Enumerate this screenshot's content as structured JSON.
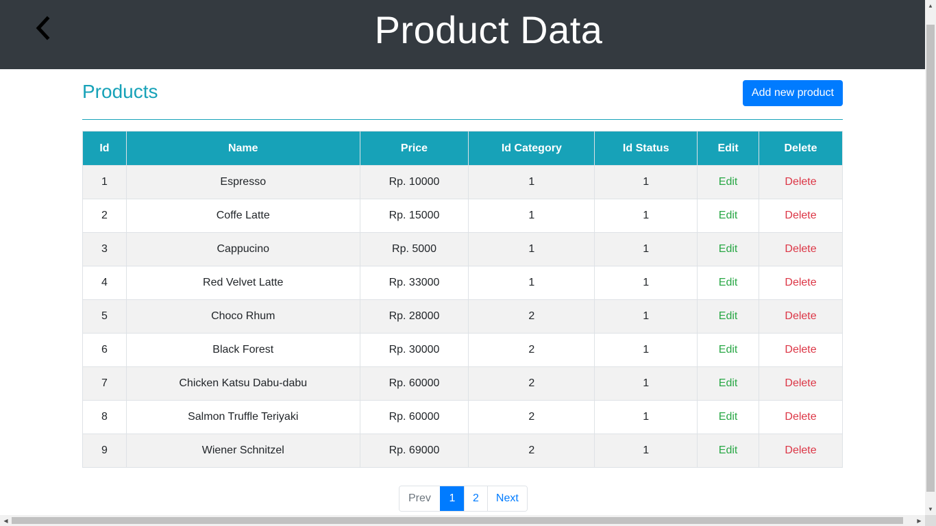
{
  "header": {
    "title": "Product Data",
    "back_icon": "chevron-left-icon"
  },
  "section": {
    "title": "Products",
    "add_button": "Add new product"
  },
  "table": {
    "columns": [
      "Id",
      "Name",
      "Price",
      "Id Category",
      "Id Status",
      "Edit",
      "Delete"
    ],
    "rows": [
      {
        "id": "1",
        "name": "Espresso",
        "price": "Rp. 10000",
        "category": "1",
        "status": "1",
        "edit": "Edit",
        "delete": "Delete"
      },
      {
        "id": "2",
        "name": "Coffe Latte",
        "price": "Rp. 15000",
        "category": "1",
        "status": "1",
        "edit": "Edit",
        "delete": "Delete"
      },
      {
        "id": "3",
        "name": "Cappucino",
        "price": "Rp. 5000",
        "category": "1",
        "status": "1",
        "edit": "Edit",
        "delete": "Delete"
      },
      {
        "id": "4",
        "name": "Red Velvet Latte",
        "price": "Rp. 33000",
        "category": "1",
        "status": "1",
        "edit": "Edit",
        "delete": "Delete"
      },
      {
        "id": "5",
        "name": "Choco Rhum",
        "price": "Rp. 28000",
        "category": "2",
        "status": "1",
        "edit": "Edit",
        "delete": "Delete"
      },
      {
        "id": "6",
        "name": "Black Forest",
        "price": "Rp. 30000",
        "category": "2",
        "status": "1",
        "edit": "Edit",
        "delete": "Delete"
      },
      {
        "id": "7",
        "name": "Chicken Katsu Dabu-dabu",
        "price": "Rp. 60000",
        "category": "2",
        "status": "1",
        "edit": "Edit",
        "delete": "Delete"
      },
      {
        "id": "8",
        "name": "Salmon Truffle Teriyaki",
        "price": "Rp. 60000",
        "category": "2",
        "status": "1",
        "edit": "Edit",
        "delete": "Delete"
      },
      {
        "id": "9",
        "name": "Wiener Schnitzel",
        "price": "Rp. 69000",
        "category": "2",
        "status": "1",
        "edit": "Edit",
        "delete": "Delete"
      }
    ]
  },
  "pagination": {
    "prev": "Prev",
    "pages": [
      "1",
      "2"
    ],
    "current": "1",
    "next": "Next"
  },
  "colors": {
    "header_bg": "#343a40",
    "accent": "#17a2b8",
    "primary": "#007bff",
    "edit": "#28a745",
    "delete": "#dc3545"
  }
}
